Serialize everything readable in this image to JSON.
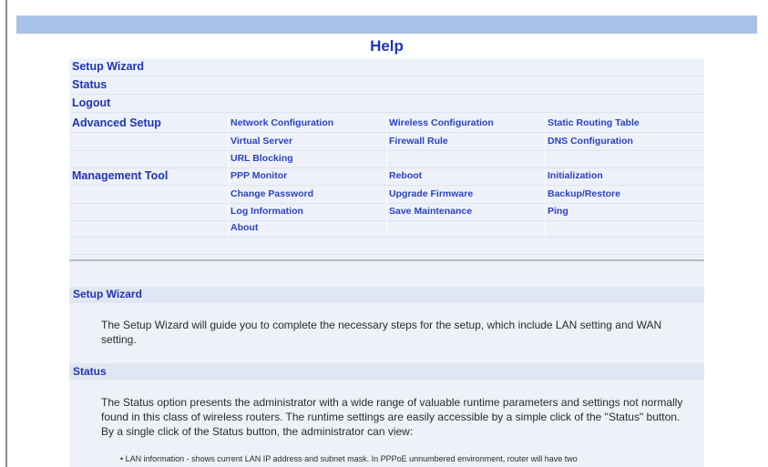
{
  "page": {
    "title": "Help"
  },
  "nav": {
    "setup_wizard": "Setup Wizard",
    "status": "Status",
    "logout": "Logout",
    "advanced_setup": {
      "label": "Advanced Setup",
      "links": [
        [
          "Network Configuration",
          "Wireless Configuration",
          "Static Routing Table"
        ],
        [
          "Virtual Server",
          "Firewall Rule",
          "DNS Configuration"
        ],
        [
          "URL Blocking",
          "",
          ""
        ]
      ]
    },
    "management_tool": {
      "label": "Management Tool",
      "links": [
        [
          "PPP Monitor",
          "Reboot",
          "Initialization"
        ],
        [
          "Change Password",
          "Upgrade Firmware",
          "Backup/Restore"
        ],
        [
          "Log Information",
          "Save Maintenance",
          "Ping"
        ],
        [
          "About",
          "",
          ""
        ]
      ]
    }
  },
  "sections": {
    "setup_wizard": {
      "heading": "Setup Wizard",
      "body": "The Setup Wizard will guide you to complete the necessary steps for the setup, which include LAN setting and WAN setting."
    },
    "status": {
      "heading": "Status",
      "body": "The Status option presents the administrator with a wide range of valuable runtime parameters and settings not normally found in this class of wireless routers. The runtime settings are easily accessible by a simple click of the \"Status\" button. By a single click of the Status button, the administrator can view:",
      "bullet": "LAN information - shows current LAN IP address and subnet mask. In PPPoE unnumbered environment, router will have two"
    }
  },
  "colors": {
    "header_bar": "#a9c3e8",
    "link": "#2b42c2",
    "panel": "#eef2f8"
  }
}
